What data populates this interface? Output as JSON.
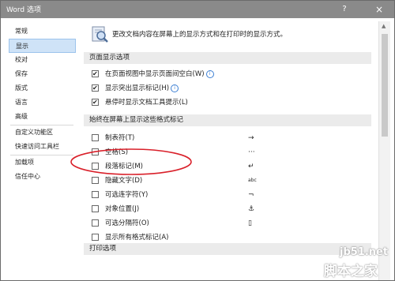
{
  "window": {
    "title": "Word 选项",
    "help_label": "?",
    "close_label": "×"
  },
  "nav": {
    "items": [
      {
        "label": "常规",
        "selected": false
      },
      {
        "label": "显示",
        "selected": true
      },
      {
        "label": "校对",
        "selected": false
      },
      {
        "label": "保存",
        "selected": false
      },
      {
        "label": "版式",
        "selected": false
      },
      {
        "label": "语言",
        "selected": false
      },
      {
        "label": "高级",
        "selected": false
      },
      {
        "label": "自定义功能区",
        "selected": false
      },
      {
        "label": "快速访问工具栏",
        "selected": false
      },
      {
        "label": "加载项",
        "selected": false
      },
      {
        "label": "信任中心",
        "selected": false
      }
    ]
  },
  "content": {
    "intro": "更改文档内容在屏幕上的显示方式和在打印时的显示方式。",
    "page_display": {
      "header": "页面显示选项",
      "options": [
        {
          "label": "在页面视图中显示页面间空白(W)",
          "checked": true,
          "info": true
        },
        {
          "label": "显示突出显示标记(H)",
          "checked": true,
          "info": true
        },
        {
          "label": "悬停时显示文档工具提示(L)",
          "checked": true,
          "info": false
        }
      ]
    },
    "format_marks": {
      "header": "始终在屏幕上显示这些格式标记",
      "options": [
        {
          "label": "制表符(T)",
          "checked": false,
          "symbol": "→"
        },
        {
          "label": "空格(S)",
          "checked": false,
          "symbol": "···"
        },
        {
          "label": "段落标记(M)",
          "checked": false,
          "symbol": "↵"
        },
        {
          "label": "隐藏文字(D)",
          "checked": false,
          "symbol": "abc"
        },
        {
          "label": "可选连字符(Y)",
          "checked": false,
          "symbol": "¬"
        },
        {
          "label": "对象位置(J)",
          "checked": false,
          "symbol": "⚓"
        },
        {
          "label": "可选分隔符(O)",
          "checked": false,
          "symbol": "▯"
        },
        {
          "label": "显示所有格式标记(A)",
          "checked": false,
          "symbol": ""
        }
      ]
    },
    "print": {
      "header": "打印选项"
    }
  },
  "watermark": {
    "domain": "jb51.net",
    "site": "脚本之家"
  },
  "colors": {
    "titlebar": "#8a8a8a",
    "nav_selected": "#cfe3f7",
    "section_bg": "#ebebeb",
    "annotation_red": "#d9202a"
  }
}
